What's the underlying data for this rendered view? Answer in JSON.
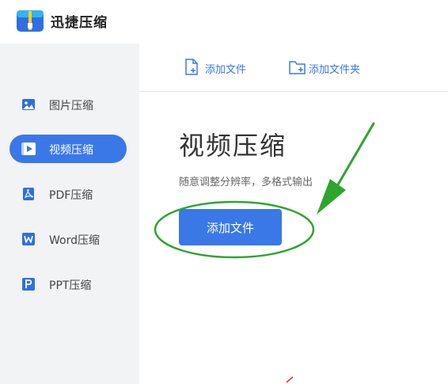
{
  "app": {
    "title": "迅捷压缩"
  },
  "sidebar": {
    "items": [
      {
        "label": "图片压缩",
        "icon": "image-icon",
        "active": false
      },
      {
        "label": "视频压缩",
        "icon": "video-icon",
        "active": true
      },
      {
        "label": "PDF压缩",
        "icon": "pdf-icon",
        "active": false
      },
      {
        "label": "Word压缩",
        "icon": "word-icon",
        "active": false
      },
      {
        "label": "PPT压缩",
        "icon": "ppt-icon",
        "active": false
      }
    ]
  },
  "toolbar": {
    "add_file_label": "添加文件",
    "add_folder_label": "添加文件夹"
  },
  "main": {
    "heading": "视频压缩",
    "subtitle": "随意调整分辨率，多格式输出",
    "add_button_label": "添加文件"
  },
  "colors": {
    "accent": "#3a78e8",
    "annotation": "#2ea52e",
    "sidebar_bg": "#f2f3f5"
  }
}
